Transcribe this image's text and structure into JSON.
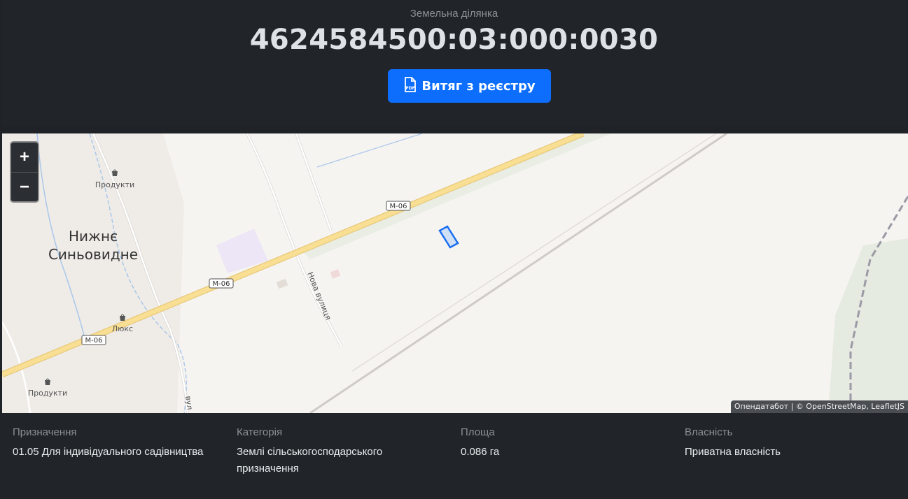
{
  "header": {
    "subtitle": "Земельна ділянка",
    "cadastral_number": "4624584500:03:000:0030",
    "button_label": "Витяг з реєстру",
    "button_icon": "pdf-file-icon"
  },
  "map": {
    "zoom_in": "+",
    "zoom_out": "−",
    "labels": {
      "village": [
        "Нижнє",
        "Синьовидне"
      ],
      "shop1": "Продукти",
      "shop2": "Люкс",
      "shop3": "Продукти",
      "street": "Нова вулиця",
      "street2": "вул",
      "road1": "М-06",
      "road2": "М-06",
      "road3": "М-06"
    },
    "attribution": "Опендатабот | © OpenStreetMap, LeafletJS",
    "colors": {
      "parcel": "#1a6ef0",
      "road_main": "#f9df94"
    }
  },
  "details": [
    {
      "label": "Призначення",
      "value": "01.05 Для індивідуального садівництва"
    },
    {
      "label": "Категорія",
      "value": "Землі сільськогосподарського призначення"
    },
    {
      "label": "Площа",
      "value": "0.086 га"
    },
    {
      "label": "Власність",
      "value": "Приватна власність"
    }
  ]
}
